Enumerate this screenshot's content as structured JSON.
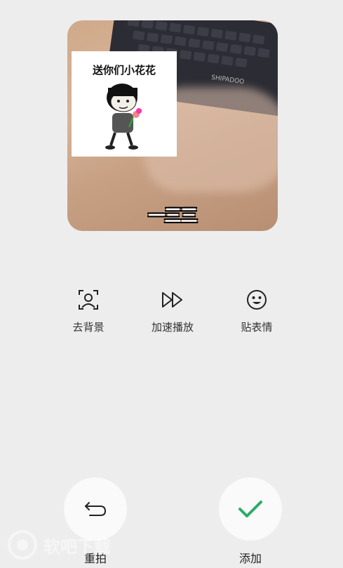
{
  "preview": {
    "sticker_text": "送你们小花花",
    "caption": "一三三",
    "keyboard_brand": "SHIPADOO"
  },
  "tools": [
    {
      "label": "去背景",
      "icon": "portrait-icon"
    },
    {
      "label": "加速播放",
      "icon": "fast-forward-icon"
    },
    {
      "label": "贴表情",
      "icon": "smiley-icon"
    }
  ],
  "actions": {
    "retake_label": "重拍",
    "add_label": "添加"
  },
  "watermark": {
    "text": "软吧下载"
  },
  "colors": {
    "accent_green": "#2aae67",
    "background": "#ededed"
  }
}
